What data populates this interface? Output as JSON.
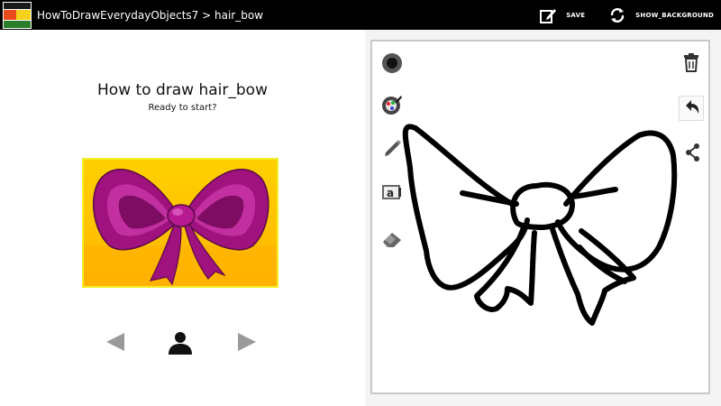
{
  "actionbar": {
    "app_icon_text": "HOW TO DRAW EVERYDAY",
    "breadcrumb": "HowToDrawEverydayObjects7 > hair_bow",
    "save_label": "SAVE",
    "show_background_label": "SHOW_BACKGROUND",
    "background_color": "#000000"
  },
  "lesson": {
    "title": "How to draw hair_bow",
    "subtitle": "Ready to start?",
    "reference_image_icon": "pink-bow-illustration"
  },
  "navigation": {
    "prev_icon": "left-triangle-icon",
    "person_icon": "person-icon",
    "next_icon": "right-triangle-icon",
    "arrow_color": "#9a9a9a"
  },
  "toolbar": {
    "tools": [
      "brush-size-icon",
      "color-picker-icon",
      "pencil-icon",
      "text-icon",
      "eraser-icon"
    ],
    "right_tools": [
      "trash-icon",
      "undo-icon",
      "share-icon"
    ]
  },
  "colors": {
    "frame_border": "#f2ee27",
    "bow_magenta": "#a0127e",
    "bow_highlight": "#d23fb0",
    "canvas_border": "#c8c8c8"
  }
}
